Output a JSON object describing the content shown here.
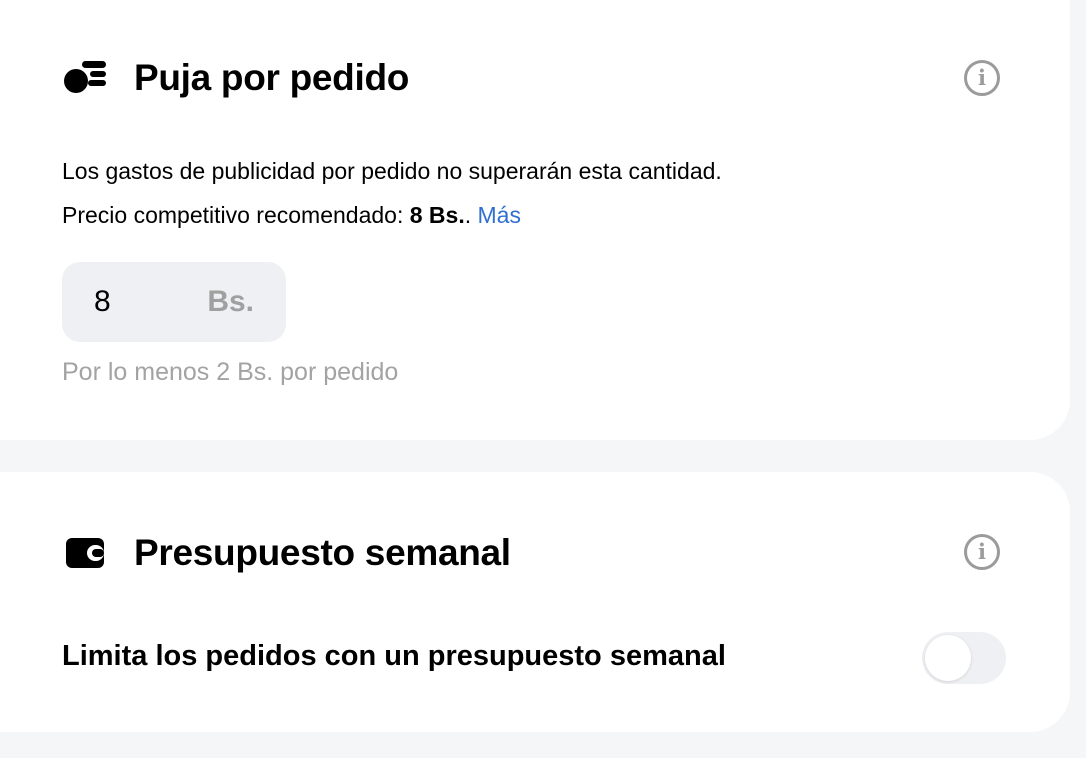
{
  "bid_section": {
    "icon": "coins-icon",
    "title": "Puja por pedido",
    "info_icon": "info-icon",
    "description": "Los gastos de publicidad por pedido no superarán esta cantidad.",
    "recommended_prefix": "Precio competitivo recomendado: ",
    "recommended_value": "8 Bs.",
    "recommended_suffix": ". ",
    "more_link": "Más",
    "input_value": "8",
    "input_unit": "Bs.",
    "hint": "Por lo menos 2 Bs. por pedido"
  },
  "budget_section": {
    "icon": "wallet-icon",
    "title": "Presupuesto semanal",
    "info_icon": "info-icon",
    "toggle_label": "Limita los pedidos con un presupuesto semanal",
    "toggle_on": false
  },
  "colors": {
    "link": "#2f6fd0",
    "page_background": "#f5f6f8",
    "card_background": "#ffffff",
    "input_background": "#eff0f3",
    "muted_text": "#a3a3a3"
  }
}
